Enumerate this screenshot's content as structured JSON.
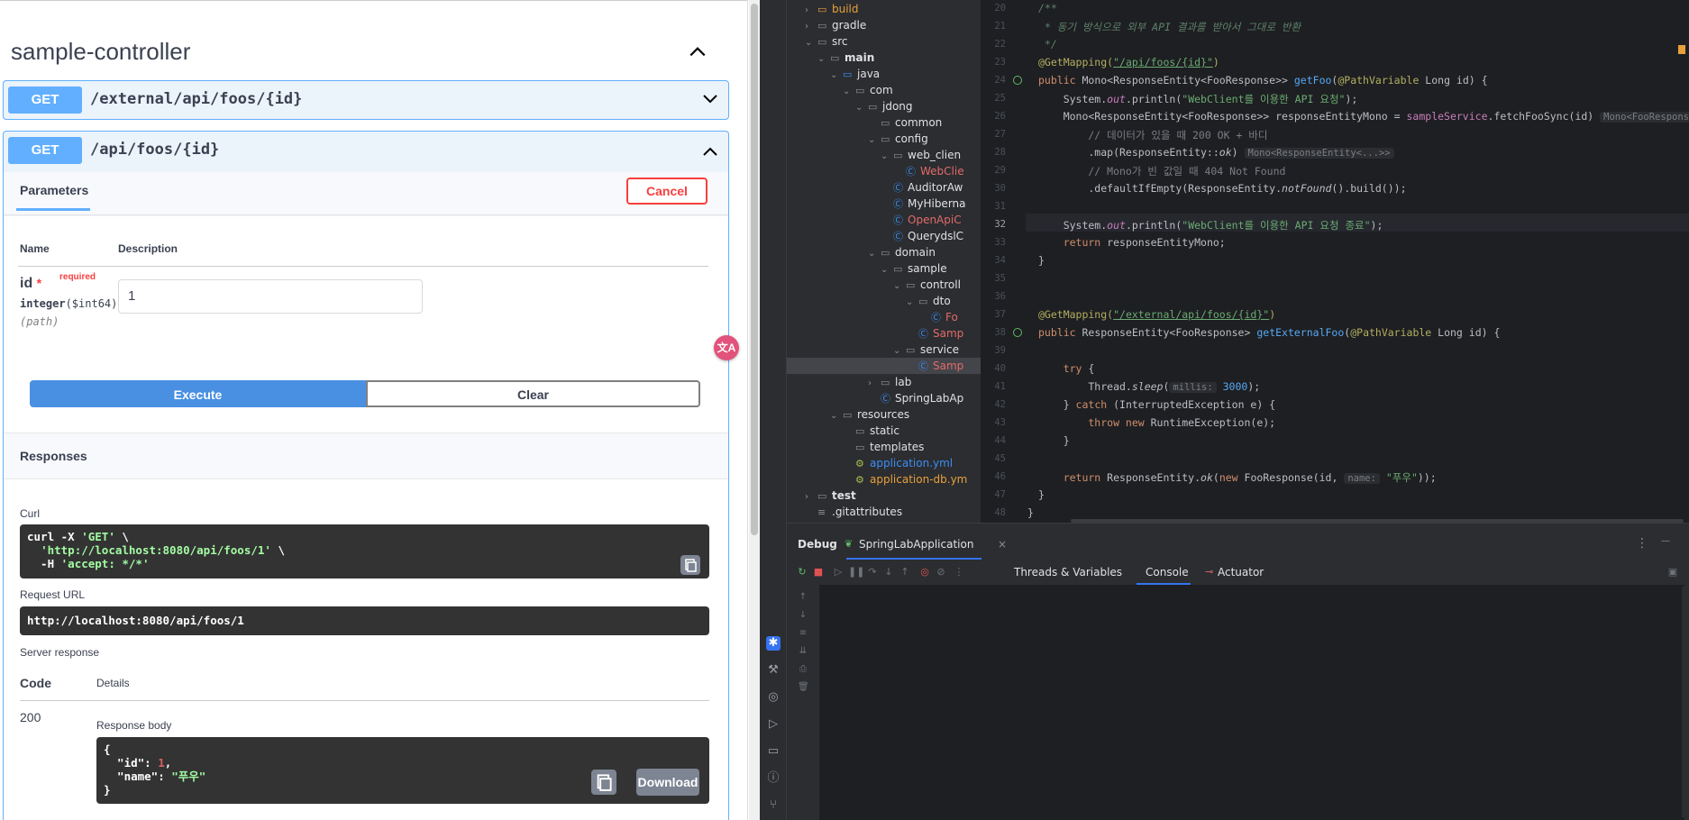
{
  "swagger": {
    "controller_title": "sample-controller",
    "ops": [
      {
        "method": "GET",
        "path": "/external/api/foos/{id}"
      },
      {
        "method": "GET",
        "path": "/api/foos/{id}"
      }
    ],
    "tab_parameters": "Parameters",
    "cancel_label": "Cancel",
    "col_name": "Name",
    "col_description": "Description",
    "param": {
      "name": "id",
      "star": "*",
      "required": "required",
      "type": "integer",
      "format": "($int64)",
      "in": "(path)",
      "value": "1"
    },
    "execute_label": "Execute",
    "clear_label": "Clear",
    "responses_title": "Responses",
    "curl_label": "Curl",
    "curl_lines": {
      "l1_a": "curl -X ",
      "l1_b": "'GET'",
      "l1_c": " \\",
      "l2_a": "  ",
      "l2_b": "'http://localhost:8080/api/foos/1'",
      "l2_c": " \\",
      "l3_a": "  -H ",
      "l3_b": "'accept: */*'"
    },
    "request_url_label": "Request URL",
    "request_url": "http://localhost:8080/api/foos/1",
    "server_response_label": "Server response",
    "code_col": "Code",
    "details_col": "Details",
    "status_code": "200",
    "response_body_label": "Response body",
    "response_body": {
      "open": "{",
      "id_key": "  \"id\"",
      "id_val": "1",
      "name_key": "  \"name\"",
      "name_val": "\"푸우\"",
      "close": "}"
    },
    "download_label": "Download",
    "translate_badge": "文A"
  },
  "tree": {
    "items": [
      {
        "label": "build",
        "color": "#e8a03c"
      },
      {
        "label": "gradle"
      },
      {
        "label": "src"
      },
      {
        "label": "main"
      },
      {
        "label": "java"
      },
      {
        "label": "com"
      },
      {
        "label": "jdong"
      },
      {
        "label": "common"
      },
      {
        "label": "config"
      },
      {
        "label": "web_clien"
      },
      {
        "label": "WebClie"
      },
      {
        "label": "AuditorAw"
      },
      {
        "label": "MyHiberna"
      },
      {
        "label": "OpenApiC"
      },
      {
        "label": "QuerydslC"
      },
      {
        "label": "domain"
      },
      {
        "label": "sample"
      },
      {
        "label": "controll"
      },
      {
        "label": "dto"
      },
      {
        "label": "Fo"
      },
      {
        "label": "Samp"
      },
      {
        "label": "service"
      },
      {
        "label": "Samp"
      },
      {
        "label": "lab"
      },
      {
        "label": "SpringLabAp"
      },
      {
        "label": "resources"
      },
      {
        "label": "static"
      },
      {
        "label": "templates"
      },
      {
        "label": "application.yml"
      },
      {
        "label": "application-db.ym"
      },
      {
        "label": "test"
      },
      {
        "label": ".gitattributes"
      }
    ]
  },
  "editor": {
    "lines": [
      "20",
      "21",
      "22",
      "23",
      "24",
      "25",
      "26",
      "27",
      "28",
      "29",
      "30",
      "31",
      "32",
      "33",
      "34",
      "35",
      "36",
      "37",
      "38",
      "39",
      "40",
      "41",
      "42",
      "43",
      "44",
      "45",
      "46",
      "47",
      "48"
    ],
    "code": {
      "c20": "/**",
      "c21": " * 동기 방식으로 외부 API 결과를 받아서 그대로 반환",
      "c22": " */",
      "c23_a": "@GetMapping(",
      "c23_b": "\"/api/foos/{id}\"",
      "c23_c": ")",
      "c24_a": "public ",
      "c24_b": "Mono<ResponseEntity<FooResponse>> ",
      "c24_c": "getFoo",
      "c24_d": "(",
      "c24_e": "@PathVariable ",
      "c24_f": "Long id) {",
      "c25_a": "    System.",
      "c25_b": "out",
      "c25_c": ".println(",
      "c25_d": "\"WebClient를 이용한 API 요청\"",
      "c25_e": ");",
      "c26_a": "    Mono<ResponseEntity<FooResponse>> responseEntityMono = ",
      "c26_b": "sampleService",
      "c26_c": ".fetchFooSync(id)",
      "c26_hint": "Mono<FooResponse>",
      "c27": "        // 데이터가 있을 때 200 OK + 바디",
      "c28_a": "        .map(ResponseEntity::",
      "c28_b": "ok",
      "c28_c": ")",
      "c28_hint": "Mono<ResponseEntity<...>>",
      "c29": "        // Mono가 빈 값일 때 404 Not Found",
      "c30_a": "        .defaultIfEmpty(ResponseEntity.",
      "c30_b": "notFound",
      "c30_c": "().build());",
      "c32_a": "    System.",
      "c32_b": "out",
      "c32_c": ".println(",
      "c32_d": "\"WebClient를 이용한 API 요청 종료\"",
      "c32_e": ");",
      "c33_a": "    return ",
      "c33_b": "responseEntityMono;",
      "c34": "}",
      "c37_a": "@GetMapping(",
      "c37_b": "\"/external/api/foos/{id}\"",
      "c37_c": ")",
      "c38_a": "public ",
      "c38_b": "ResponseEntity<FooResponse> ",
      "c38_c": "getExternalFoo",
      "c38_d": "(",
      "c38_e": "@PathVariable ",
      "c38_f": "Long id) {",
      "c40_a": "    try ",
      "c40_b": "{",
      "c41_a": "        Thread.",
      "c41_b": "sleep",
      "c41_c": "(",
      "c41_hint": "millis:",
      "c41_d": "3000",
      "c41_e": ");",
      "c42_a": "    } ",
      "c42_b": "catch ",
      "c42_c": "(InterruptedException e) {",
      "c43_a": "        throw new ",
      "c43_b": "RuntimeException(e);",
      "c44": "    }",
      "c46_a": "    return ",
      "c46_b": "ResponseEntity.",
      "c46_c": "ok",
      "c46_d": "(",
      "c46_e": "new ",
      "c46_f": "FooResponse(id, ",
      "c46_hint": "name:",
      "c46_g": "\"푸우\"",
      "c46_h": "));",
      "c47": "}",
      "c48": "}"
    }
  },
  "debug": {
    "title": "Debug",
    "run_tab": "SpringLabApplication",
    "close": "×",
    "threads_tab": "Threads & Variables",
    "console_tab": "Console",
    "actuator_tab": "Actuator",
    "more": "⋮",
    "minimize": "—"
  }
}
